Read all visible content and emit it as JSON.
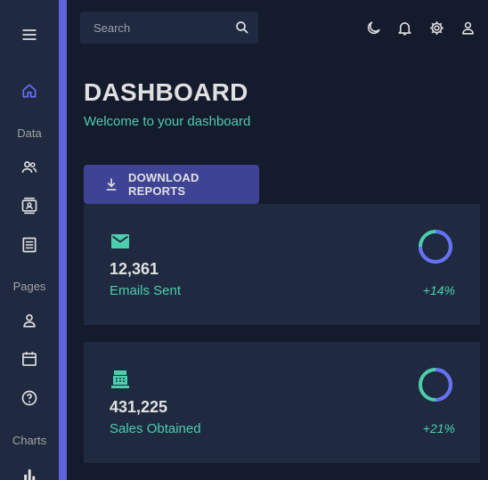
{
  "sidebar": {
    "sections": [
      "Data",
      "Pages",
      "Charts"
    ]
  },
  "search": {
    "placeholder": "Search"
  },
  "header": {
    "title": "DASHBOARD",
    "subtitle": "Welcome to your dashboard"
  },
  "download_button": {
    "label": "DOWNLOAD REPORTS"
  },
  "stats": [
    {
      "value": "12,361",
      "label": "Emails Sent",
      "increase": "+14%",
      "progress": 0.75,
      "icon": "email-icon"
    },
    {
      "value": "431,225",
      "label": "Sales Obtained",
      "increase": "+21%",
      "progress": 0.5,
      "icon": "point-of-sale-icon"
    }
  ],
  "colors": {
    "background": "#141b2d",
    "panel": "#1f2a40",
    "accent_green": "#4cceac",
    "accent_blue": "#6870fa",
    "button": "#3e4396"
  }
}
